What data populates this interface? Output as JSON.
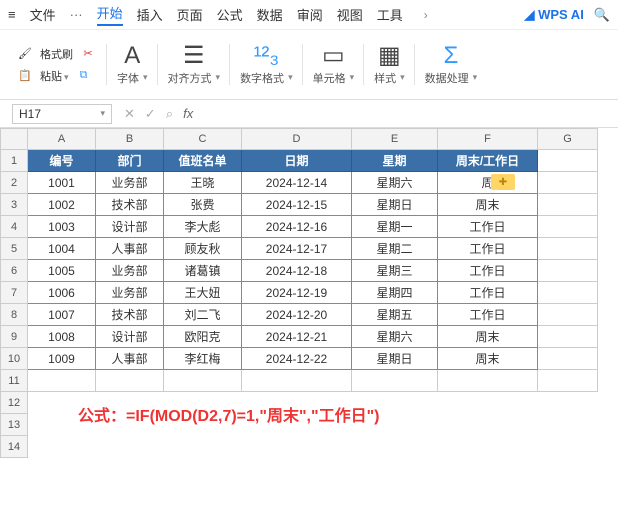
{
  "menubar": {
    "file": "文件",
    "ellipsis": "···",
    "tabs": [
      "开始",
      "插入",
      "页面",
      "公式",
      "数据",
      "审阅",
      "视图",
      "工具"
    ],
    "active_index": 0,
    "wpsai": "WPS AI"
  },
  "toolbar": {
    "clipboard": {
      "format_painter": "格式刷",
      "paste": "粘贴"
    },
    "font_group": "字体",
    "align_group": "对齐方式",
    "number_group": "数字格式",
    "cell_group": "单元格",
    "style_group": "样式",
    "data_group": "数据处理"
  },
  "formula_bar": {
    "name_box": "H17",
    "fx": "fx"
  },
  "columns": [
    "A",
    "B",
    "C",
    "D",
    "E",
    "F",
    "G"
  ],
  "row_numbers": [
    "1",
    "2",
    "3",
    "4",
    "5",
    "6",
    "7",
    "8",
    "9",
    "10",
    "11",
    "12",
    "13",
    "14"
  ],
  "header_row": [
    "编号",
    "部门",
    "值班名单",
    "日期",
    "星期",
    "周末/工作日"
  ],
  "data_rows": [
    [
      "1001",
      "业务部",
      "王晓",
      "2024-12-14",
      "星期六",
      "周"
    ],
    [
      "1002",
      "技术部",
      "张费",
      "2024-12-15",
      "星期日",
      "周末"
    ],
    [
      "1003",
      "设计部",
      "李大彪",
      "2024-12-16",
      "星期一",
      "工作日"
    ],
    [
      "1004",
      "人事部",
      "顾友秋",
      "2024-12-17",
      "星期二",
      "工作日"
    ],
    [
      "1005",
      "业务部",
      "诸葛镇",
      "2024-12-18",
      "星期三",
      "工作日"
    ],
    [
      "1006",
      "业务部",
      "王大妞",
      "2024-12-19",
      "星期四",
      "工作日"
    ],
    [
      "1007",
      "技术部",
      "刘二飞",
      "2024-12-20",
      "星期五",
      "工作日"
    ],
    [
      "1008",
      "设计部",
      "欧阳克",
      "2024-12-21",
      "星期六",
      "周末"
    ],
    [
      "1009",
      "人事部",
      "李红梅",
      "2024-12-22",
      "星期日",
      "周末"
    ]
  ],
  "formula_annotation": "公式：=IF(MOD(D2,7)=1,\"周末\",\"工作日\")"
}
